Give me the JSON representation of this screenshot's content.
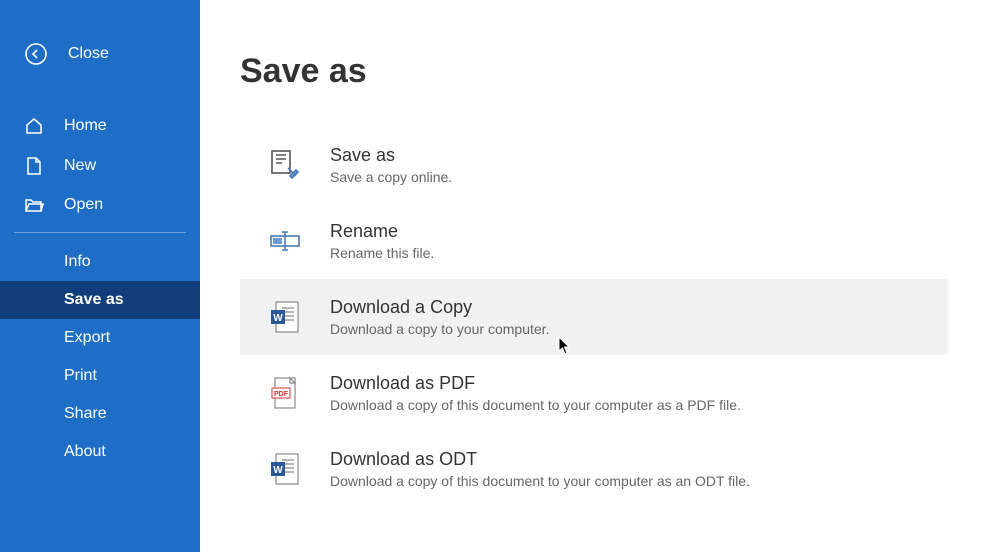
{
  "sidebar": {
    "close": "Close",
    "items": [
      {
        "label": "Home"
      },
      {
        "label": "New"
      },
      {
        "label": "Open"
      },
      {
        "label": "Info"
      },
      {
        "label": "Save as"
      },
      {
        "label": "Export"
      },
      {
        "label": "Print"
      },
      {
        "label": "Share"
      },
      {
        "label": "About"
      }
    ]
  },
  "main": {
    "title": "Save as",
    "options": [
      {
        "title": "Save as",
        "desc": "Save a copy online."
      },
      {
        "title": "Rename",
        "desc": "Rename this file."
      },
      {
        "title": "Download a Copy",
        "desc": "Download a copy to your computer."
      },
      {
        "title": "Download as PDF",
        "desc": "Download a copy of this document to your computer as a PDF file."
      },
      {
        "title": "Download as ODT",
        "desc": "Download a copy of this document to your computer as an ODT file."
      }
    ]
  }
}
